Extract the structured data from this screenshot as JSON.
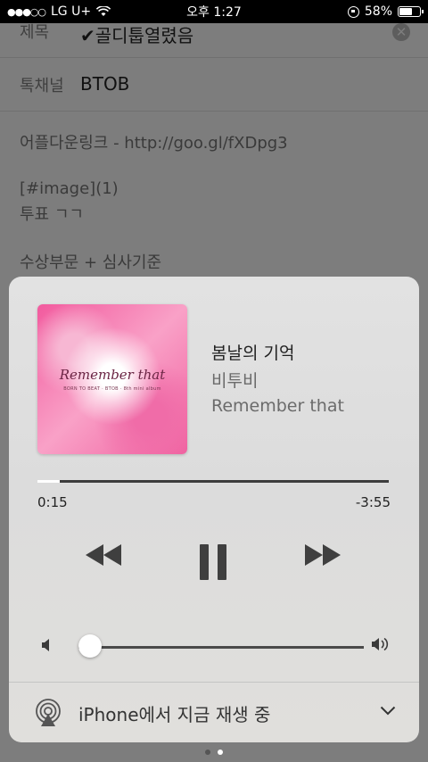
{
  "status_bar": {
    "carrier": "LG U+",
    "time": "오후 1:27",
    "battery": "58%"
  },
  "form": {
    "title_label": "제목",
    "title_value": "✔골디툽열렸음",
    "channel_label": "톡채널",
    "channel_value": "BTOB",
    "body_lines": [
      "어플다운링크 - http://goo.gl/fXDpg3",
      "[#image](1)",
      "투표 ㄱㄱ",
      "수상부문 + 심사기준"
    ]
  },
  "now_playing": {
    "album_art_title": "Remember that",
    "album_art_subtitle": "BORN TO BEAT · BTOB · 8th mini album",
    "song_title": "봄날의 기억",
    "artist": "비투비",
    "album": "Remember that",
    "elapsed": "0:15",
    "remaining": "-3:55",
    "progress_fraction": 0.064,
    "volume_fraction": 0.04,
    "output_label": "iPhone에서 지금 재생 중"
  }
}
